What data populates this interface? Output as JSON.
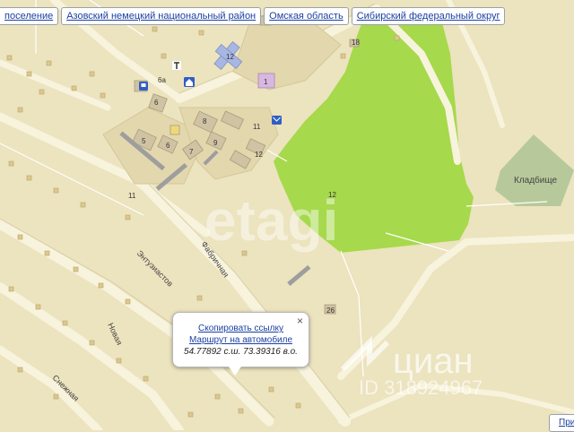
{
  "breadcrumbs": [
    {
      "label": "поселение"
    },
    {
      "label": "Азовский немецкий национальный район"
    },
    {
      "label": "Омская область"
    },
    {
      "label": "Сибирский федеральный округ"
    }
  ],
  "popup": {
    "copy_link": "Скопировать ссылку",
    "route": "Маршрут на автомобиле",
    "coords": "54.77892 с.ш. 73.39316 в.о.",
    "close": "×"
  },
  "corner_link": "При",
  "map_labels": {
    "street_fabrichnaya": "Фабричная",
    "street_entuziastov": "Энтузиастов",
    "street_novaya": "Новая",
    "street_snezhnaya": "Снежная",
    "cemetery": "Кладбище",
    "houses": {
      "h12_top": "12",
      "h1": "1",
      "h18": "18",
      "h6a": "6а",
      "h6b": "6",
      "h8": "8",
      "h11a": "11",
      "h5": "5",
      "h6c": "6",
      "h7": "7",
      "h9": "9",
      "h12b": "12",
      "h11b": "11",
      "h12c": "12",
      "h26": "26"
    }
  },
  "watermarks": {
    "etagi": "etagi",
    "cian": "циан",
    "cian_id": "ID 318924967"
  },
  "colors": {
    "land": "#ece3bf",
    "forest": "#a6d94b",
    "cemetery": "#b7c99a",
    "road": "#f8f3dc",
    "building": "#cfc3a3",
    "link": "#1a3fa0"
  }
}
